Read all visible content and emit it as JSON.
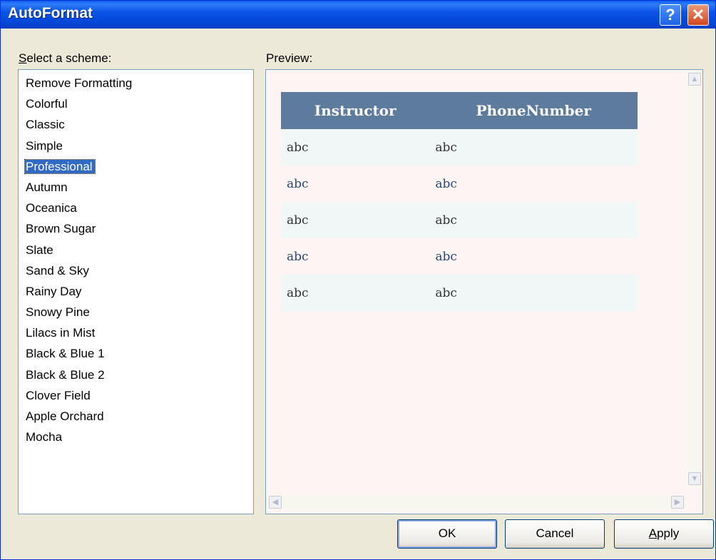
{
  "window": {
    "title": "AutoFormat",
    "help_glyph": "?",
    "close_glyph": "✕"
  },
  "schemes": {
    "label_accel": "S",
    "label_rest": "elect a scheme:",
    "items": [
      "Remove Formatting",
      "Colorful",
      "Classic",
      "Simple",
      "Professional",
      "Autumn",
      "Oceanica",
      "Brown Sugar",
      "Slate",
      "Sand & Sky",
      "Rainy Day",
      "Snowy Pine",
      "Lilacs in Mist",
      "Black & Blue 1",
      "Black & Blue 2",
      "Clover Field",
      "Apple Orchard",
      "Mocha"
    ],
    "selected": "Professional"
  },
  "preview": {
    "label": "Preview:",
    "headers": [
      "Instructor",
      "PhoneNumber"
    ],
    "rows": [
      [
        "abc",
        "abc"
      ],
      [
        "abc",
        "abc"
      ],
      [
        "abc",
        "abc"
      ],
      [
        "abc",
        "abc"
      ],
      [
        "abc",
        "abc"
      ]
    ],
    "colors": {
      "header_bg": "#5d7b9d",
      "row_odd": "#f1f6f7",
      "row_even_text": "#284775"
    }
  },
  "buttons": {
    "ok": "OK",
    "cancel": "Cancel",
    "apply_accel": "A",
    "apply_rest": "pply"
  }
}
